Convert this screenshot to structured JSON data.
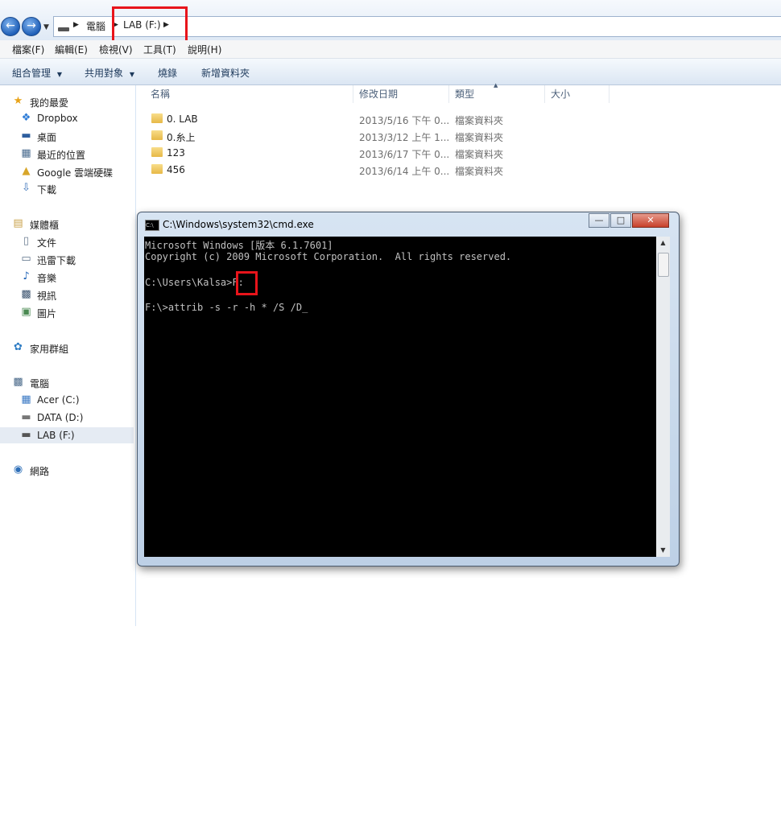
{
  "address": {
    "crumbs": [
      "電腦",
      "LAB (F:)"
    ]
  },
  "menu": [
    "檔案(F)",
    "編輯(E)",
    "檢視(V)",
    "工具(T)",
    "說明(H)"
  ],
  "toolbar": {
    "organize": "組合管理",
    "share": "共用對象",
    "burn": "燒錄",
    "new_folder": "新增資料夾"
  },
  "sidebar": {
    "favorites": {
      "title": "我的最愛",
      "items": [
        "Dropbox",
        "桌面",
        "最近的位置",
        "Google 雲端硬碟",
        "下載"
      ]
    },
    "libraries": {
      "title": "媒體櫃",
      "items": [
        "文件",
        "迅雷下載",
        "音樂",
        "視訊",
        "圖片"
      ]
    },
    "homegroup": {
      "title": "家用群組"
    },
    "computer": {
      "title": "電腦",
      "items": [
        "Acer (C:)",
        "DATA (D:)",
        "LAB (F:)"
      ]
    },
    "network": {
      "title": "網路"
    }
  },
  "columns": {
    "name": "名稱",
    "date": "修改日期",
    "type": "類型",
    "size": "大小"
  },
  "files": [
    {
      "name": "0. LAB",
      "date": "2013/5/16 下午 0...",
      "type": "檔案資料夾"
    },
    {
      "name": "0.糸上",
      "date": "2013/3/12 上午 1...",
      "type": "檔案資料夾"
    },
    {
      "name": "123",
      "date": "2013/6/17 下午 0...",
      "type": "檔案資料夾"
    },
    {
      "name": "456",
      "date": "2013/6/14 上午 0...",
      "type": "檔案資料夾"
    }
  ],
  "cmd": {
    "title": "C:\\Windows\\system32\\cmd.exe",
    "lines": [
      "Microsoft Windows [版本 6.1.7601]",
      "Copyright (c) 2009 Microsoft Corporation.  All rights reserved.",
      "C:\\Users\\Kalsa>F:",
      "F:\\>attrib -s -r -h * /S /D_"
    ]
  },
  "colors": {
    "highlight": "#e8141b",
    "cmd_background": "#000000",
    "cmd_text": "#c0c0c0"
  }
}
